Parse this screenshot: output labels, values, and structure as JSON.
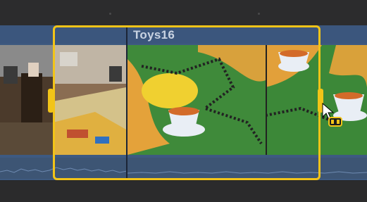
{
  "timeline": {
    "clip_title": "Toys16"
  },
  "colors": {
    "selection": "#f2c418",
    "clip": "#3e5a80",
    "background": "#2a2a2b"
  },
  "icons": {
    "cursor": "arrow-cursor-icon",
    "trim": "film-trim-icon"
  }
}
